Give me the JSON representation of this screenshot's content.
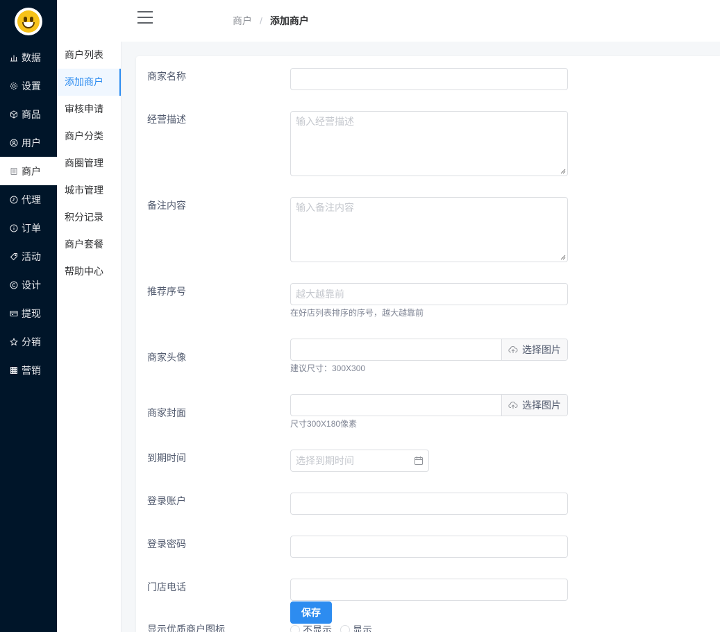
{
  "sidebar": {
    "items": [
      {
        "label": "数据",
        "icon": "bar-chart-icon"
      },
      {
        "label": "设置",
        "icon": "gear-icon"
      },
      {
        "label": "商品",
        "icon": "box-icon"
      },
      {
        "label": "用户",
        "icon": "user-icon"
      },
      {
        "label": "商户",
        "icon": "document-icon",
        "active": true
      },
      {
        "label": "代理",
        "icon": "clock-icon"
      },
      {
        "label": "订单",
        "icon": "info-icon"
      },
      {
        "label": "活动",
        "icon": "tag-icon"
      },
      {
        "label": "设计",
        "icon": "copyright-icon"
      },
      {
        "label": "提现",
        "icon": "card-icon"
      },
      {
        "label": "分销",
        "icon": "star-icon"
      },
      {
        "label": "营销",
        "icon": "grid-icon"
      }
    ]
  },
  "submenu": {
    "items": [
      {
        "label": "商户列表"
      },
      {
        "label": "添加商户",
        "active": true
      },
      {
        "label": "审核申请"
      },
      {
        "label": "商户分类"
      },
      {
        "label": "商圈管理"
      },
      {
        "label": "城市管理"
      },
      {
        "label": "积分记录"
      },
      {
        "label": "商户套餐"
      },
      {
        "label": "帮助中心"
      }
    ]
  },
  "breadcrumb": {
    "first": "商户",
    "separator": "/",
    "current": "添加商户"
  },
  "form": {
    "name": {
      "label": "商家名称",
      "value": "",
      "placeholder": ""
    },
    "description": {
      "label": "经营描述",
      "placeholder": "输入经营描述"
    },
    "remark": {
      "label": "备注内容",
      "placeholder": "输入备注内容"
    },
    "sort": {
      "label": "推荐序号",
      "placeholder": "越大越靠前",
      "help": "在好店列表排序的序号，越大越靠前"
    },
    "avatar": {
      "label": "商家头像",
      "button": "选择图片",
      "help": "建议尺寸：300X300"
    },
    "cover": {
      "label": "商家封面",
      "button": "选择图片",
      "help": "尺寸300X180像素"
    },
    "expire": {
      "label": "到期时间",
      "placeholder": "选择到期时间"
    },
    "account": {
      "label": "登录账户",
      "value": ""
    },
    "password": {
      "label": "登录密码",
      "value": ""
    },
    "phone": {
      "label": "门店电话",
      "value": ""
    },
    "quality": {
      "label": "显示优质商户图标",
      "options": [
        "不显示",
        "显示"
      ]
    },
    "save": "保存"
  },
  "colors": {
    "sidebar_bg": "#001529",
    "primary": "#2d8cf0"
  }
}
